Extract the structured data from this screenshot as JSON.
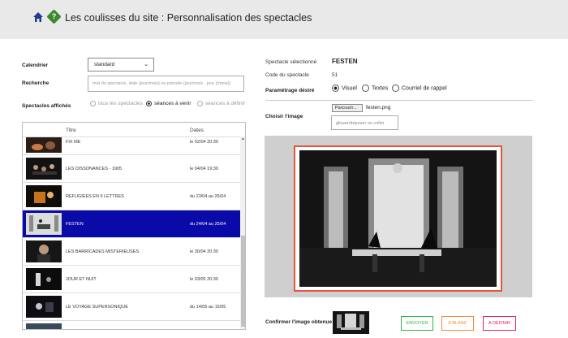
{
  "header": {
    "title": "Les coulisses du site : Personnalisation des spectacles",
    "home_icon": "home-icon",
    "help_icon": "help-icon",
    "help_glyph": "?"
  },
  "filters": {
    "calendrier_label": "Calendrier",
    "calendrier_value": "standard",
    "recherche_label": "Recherche",
    "recherche_placeholder": "mot du spectacle, date (jour/mois) ou période (jour/mois - jour (/mois))",
    "affiches_label": "Spectacles affichés",
    "options": [
      {
        "label": "tous les spectacles",
        "selected": false
      },
      {
        "label": "séances à venir",
        "selected": true
      },
      {
        "label": "séances à définir",
        "selected": false
      }
    ]
  },
  "table": {
    "col_title": "Titre",
    "col_dates": "Dates",
    "rows": [
      {
        "title": "FIX ME",
        "dates": "le 02/04 20:30",
        "selected": false
      },
      {
        "title": "LES DISSONANCES - 1905",
        "dates": "le 04/04 19:30",
        "selected": false
      },
      {
        "title": "REFUGIEES EN 9 LETTRES",
        "dates": "du 23/04 au 26/04",
        "selected": false
      },
      {
        "title": "FESTEN",
        "dates": "du 24/04 au 25/04",
        "selected": true
      },
      {
        "title": "LES BARRICADES MISTERIEUSES",
        "dates": "le 30/04 20:30",
        "selected": false
      },
      {
        "title": "JOUR ET NUIT",
        "dates": "le 03/05 20:30",
        "selected": false
      },
      {
        "title": "LE VOYAGE SUPERSONIQUE",
        "dates": "du 14/05 au 15/05",
        "selected": false
      }
    ]
  },
  "details": {
    "spectacle_label": "Spectacle sélectionné",
    "spectacle_value": "FESTEN",
    "code_label": "Code du spectacle",
    "code_value": "51",
    "param_label": "Paramétrage désiré",
    "param_options": [
      {
        "label": "Visuel",
        "selected": true
      },
      {
        "label": "Textes",
        "selected": false
      },
      {
        "label": "Courriel de rappel",
        "selected": false
      }
    ],
    "image_label": "Choisir l'image",
    "browse_label": "Parcourir...",
    "filename": "festen.png",
    "dropzone": "glisser/déposer ou coller",
    "confirm_label": "Confirmer l'image obtenue"
  },
  "actions": {
    "envoyer": "ENVOYER",
    "blanc": "A BLANC",
    "definir": "A DÉFINIR"
  },
  "colors": {
    "selection": "#0a0aa8",
    "crop_frame": "#e4553a",
    "envoyer": "#2db34a",
    "blanc": "#f08a3c",
    "definir": "#e0245e"
  }
}
